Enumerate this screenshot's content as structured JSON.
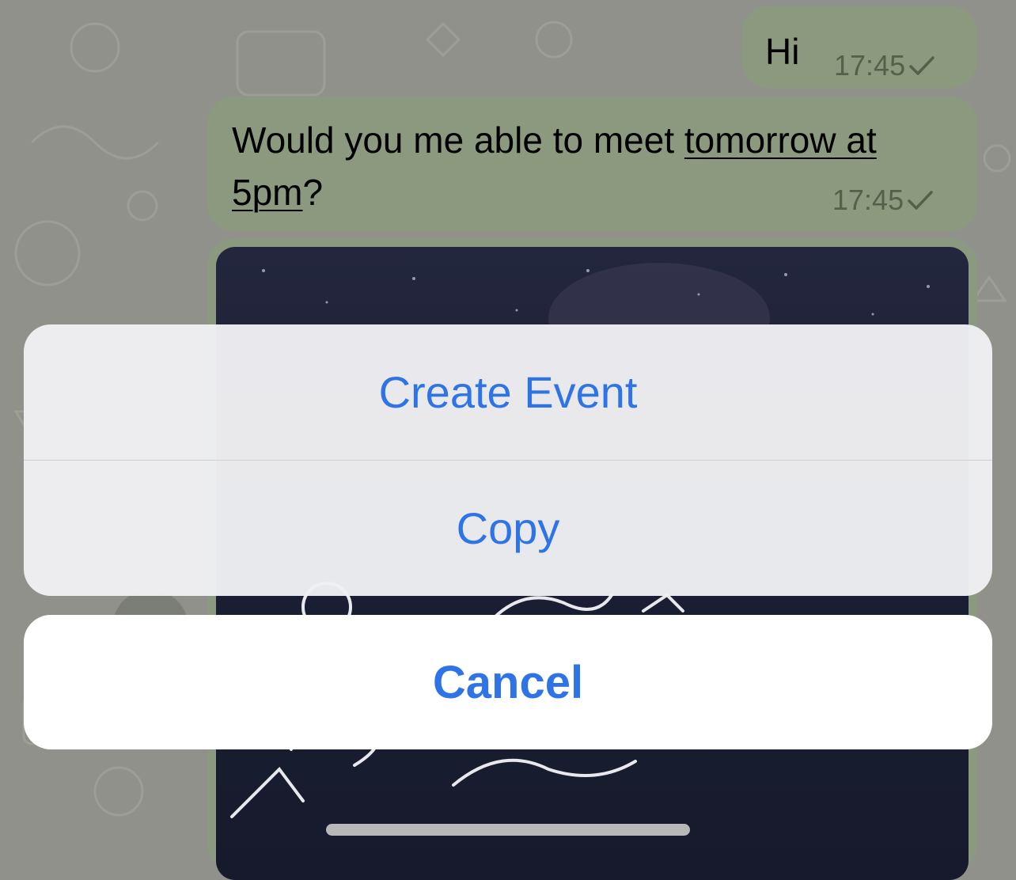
{
  "messages": [
    {
      "text": "Hi",
      "time": "17:45"
    },
    {
      "text_before": "Would you me able to meet ",
      "link_text_1": "tomorrow at",
      "link_text_2": "5pm",
      "text_after": "?",
      "time": "17:45"
    }
  ],
  "action_sheet": {
    "items": [
      "Create Event",
      "Copy"
    ],
    "cancel_label": "Cancel"
  },
  "colors": {
    "accent": "#2f74e6",
    "bubble": "#8b9a7e",
    "background": "#8f918a"
  }
}
